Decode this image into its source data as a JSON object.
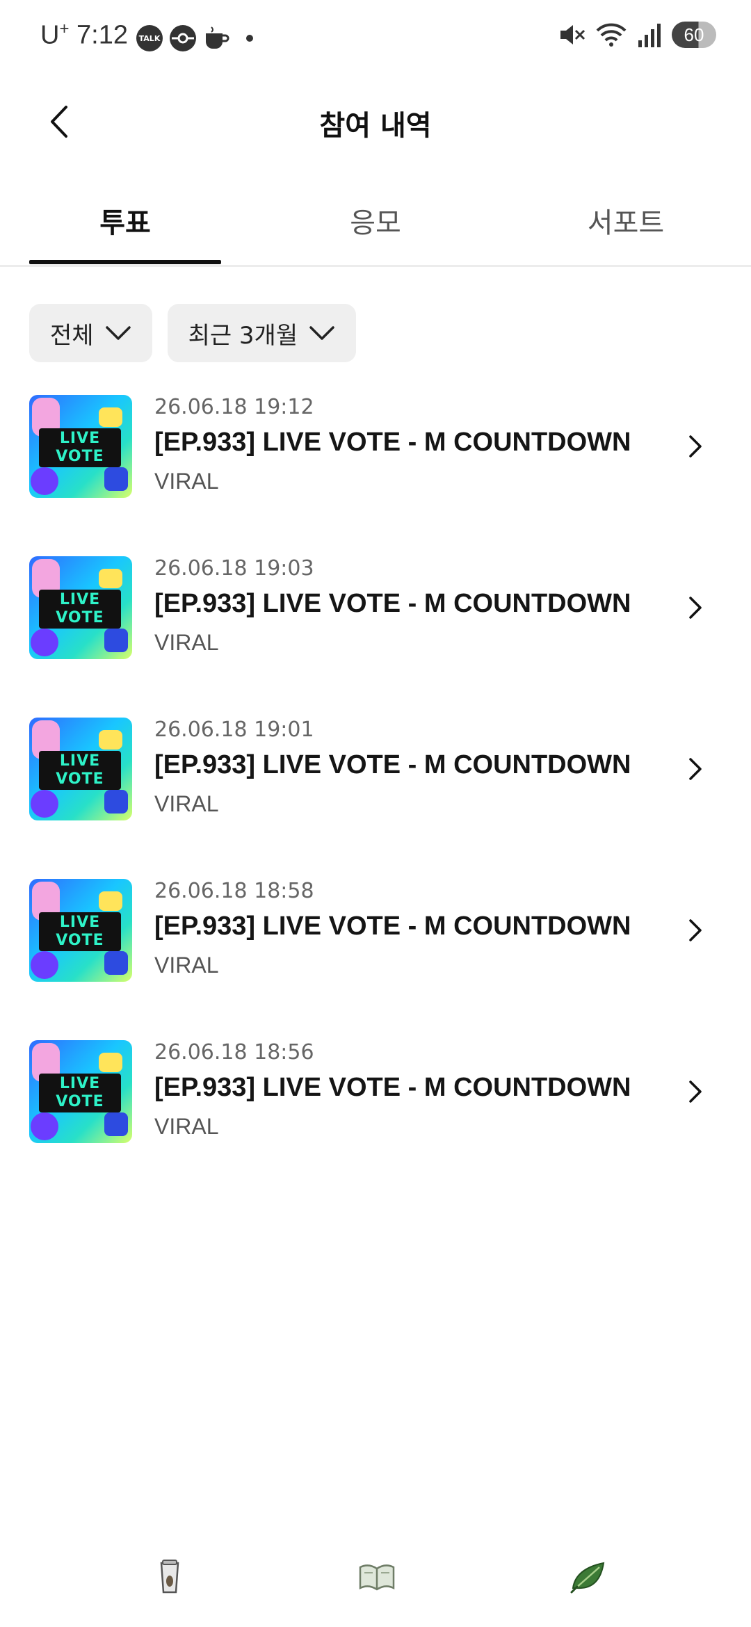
{
  "status_bar": {
    "carrier": "U",
    "carrier_sup": "+",
    "time": "7:12",
    "notif_icons": [
      "talk-icon",
      "pokeball-icon",
      "coffee-icon"
    ],
    "talk_label": "TALK",
    "battery": "60"
  },
  "header": {
    "title": "참여 내역"
  },
  "tabs": [
    {
      "label": "투표",
      "active": true
    },
    {
      "label": "응모",
      "active": false
    },
    {
      "label": "서포트",
      "active": false
    }
  ],
  "filters": {
    "category": "전체",
    "period": "최근 3개월"
  },
  "thumb_label": "LIVE VOTE",
  "items": [
    {
      "date": "26.06.18 19:12",
      "title": "[EP.933] LIVE VOTE - M COUNTDOWN",
      "source": "VIRAL"
    },
    {
      "date": "26.06.18 19:03",
      "title": "[EP.933] LIVE VOTE - M COUNTDOWN",
      "source": "VIRAL"
    },
    {
      "date": "26.06.18 19:01",
      "title": "[EP.933] LIVE VOTE - M COUNTDOWN",
      "source": "VIRAL"
    },
    {
      "date": "26.06.18 18:58",
      "title": "[EP.933] LIVE VOTE - M COUNTDOWN",
      "source": "VIRAL"
    },
    {
      "date": "26.06.18 18:56",
      "title": "[EP.933] LIVE VOTE - M COUNTDOWN",
      "source": "VIRAL"
    }
  ],
  "bottom_nav": [
    "cup-icon",
    "book-icon",
    "leaf-icon"
  ]
}
